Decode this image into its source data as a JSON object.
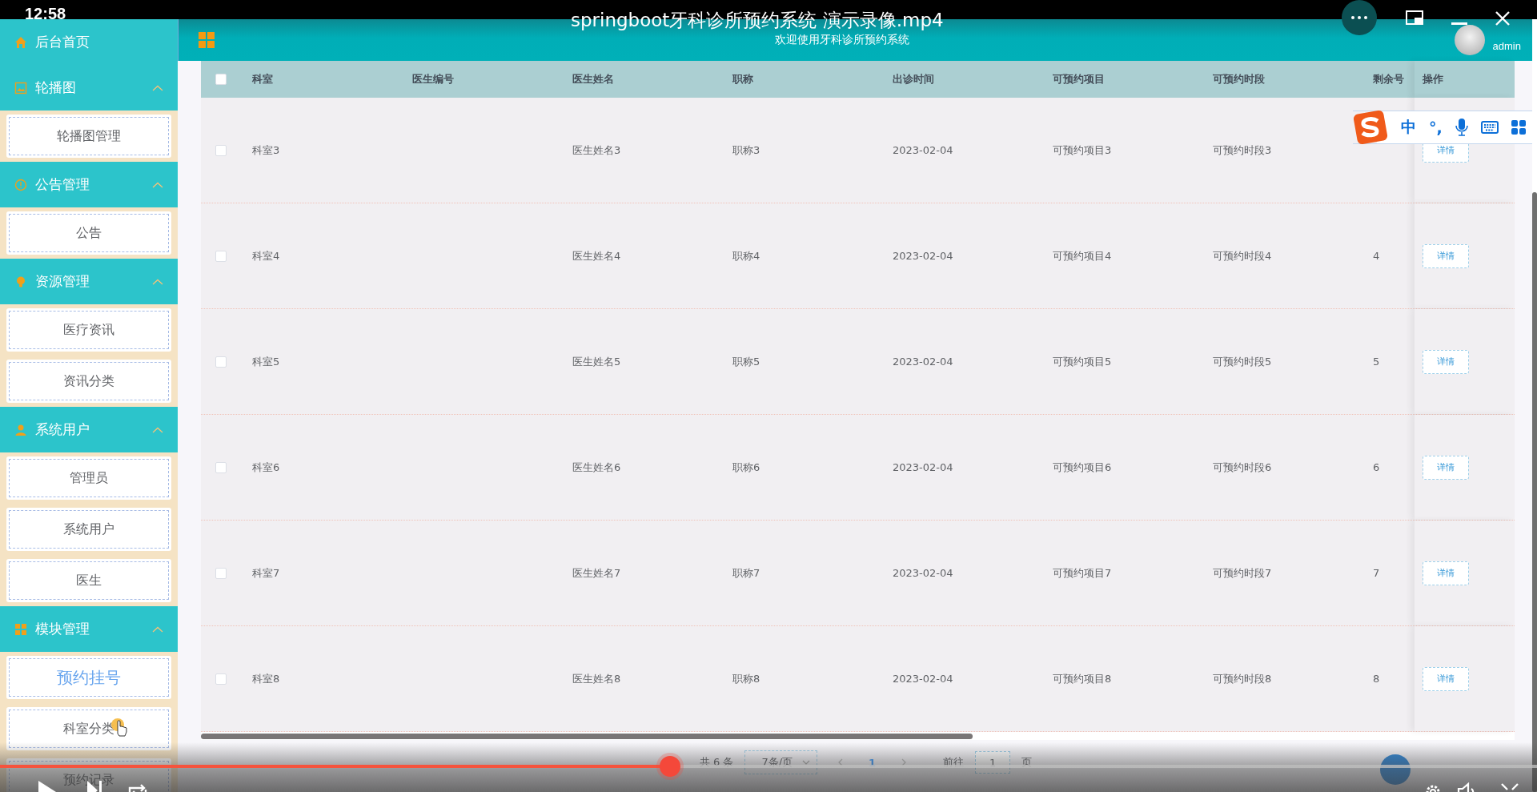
{
  "player": {
    "clock": "12:58",
    "title": "springboot牙科诊所预约系统 演示录像.mp4",
    "progress": {
      "level": 0.436
    }
  },
  "header": {
    "welcome": "欢迎使用牙科诊所预约系统",
    "user": "admin"
  },
  "sidebar": {
    "home": "后台首页",
    "groups": [
      {
        "title": "轮播图",
        "expanded": true,
        "items": [
          {
            "label": "轮播图管理",
            "selected": false
          }
        ]
      },
      {
        "title": "公告管理",
        "expanded": true,
        "items": [
          {
            "label": "公告",
            "selected": false
          }
        ]
      },
      {
        "title": "资源管理",
        "expanded": true,
        "items": [
          {
            "label": "医疗资讯",
            "selected": false
          },
          {
            "label": "资讯分类",
            "selected": false
          }
        ]
      },
      {
        "title": "系统用户",
        "expanded": true,
        "items": [
          {
            "label": "管理员",
            "selected": false
          },
          {
            "label": "系统用户",
            "selected": false
          },
          {
            "label": "医生",
            "selected": false
          }
        ]
      },
      {
        "title": "模块管理",
        "expanded": true,
        "items": [
          {
            "label": "预约挂号",
            "selected": true
          },
          {
            "label": "科室分类",
            "selected": false
          },
          {
            "label": "预约记录",
            "selected": false
          }
        ]
      }
    ]
  },
  "table": {
    "header_checked": false,
    "columns": [
      "科室",
      "医生编号",
      "医生姓名",
      "职称",
      "出诊时间",
      "可预约项目",
      "可预约时段",
      "剩余号",
      "操作"
    ],
    "rows": [
      {
        "checked": false,
        "department": "科室3",
        "doctor_name": "医生姓名3",
        "title": "职称3",
        "date": "2023-02-04",
        "project": "可预约项目3",
        "slot": "可预约时段3",
        "action": "详情"
      },
      {
        "checked": false,
        "department": "科室4",
        "doctor_name": "医生姓名4",
        "title": "职称4",
        "date": "2023-02-04",
        "project": "可预约项目4",
        "slot": "可预约时段4",
        "remaining": "4",
        "action": "详情"
      },
      {
        "checked": false,
        "department": "科室5",
        "doctor_name": "医生姓名5",
        "title": "职称5",
        "date": "2023-02-04",
        "project": "可预约项目5",
        "slot": "可预约时段5",
        "remaining": "5",
        "action": "详情"
      },
      {
        "checked": false,
        "department": "科室6",
        "doctor_name": "医生姓名6",
        "title": "职称6",
        "date": "2023-02-04",
        "project": "可预约项目6",
        "slot": "可预约时段6",
        "remaining": "6",
        "action": "详情"
      },
      {
        "checked": false,
        "department": "科室7",
        "doctor_name": "医生姓名7",
        "title": "职称7",
        "date": "2023-02-04",
        "project": "可预约项目7",
        "slot": "可预约时段7",
        "remaining": "7",
        "action": "详情"
      },
      {
        "checked": false,
        "department": "科室8",
        "doctor_name": "医生姓名8",
        "title": "职称8",
        "date": "2023-02-04",
        "project": "可预约项目8",
        "slot": "可预约时段8",
        "remaining": "8",
        "action": "详情"
      }
    ]
  },
  "pagination": {
    "total": "共 6 条",
    "page_size": "7条/页",
    "pages": [
      {
        "label": "1",
        "selected": true
      }
    ],
    "goto": "前往",
    "page_input": "1",
    "page_suffix": "页"
  },
  "ime": {
    "mode": "中",
    "punctuation": "°,"
  }
}
